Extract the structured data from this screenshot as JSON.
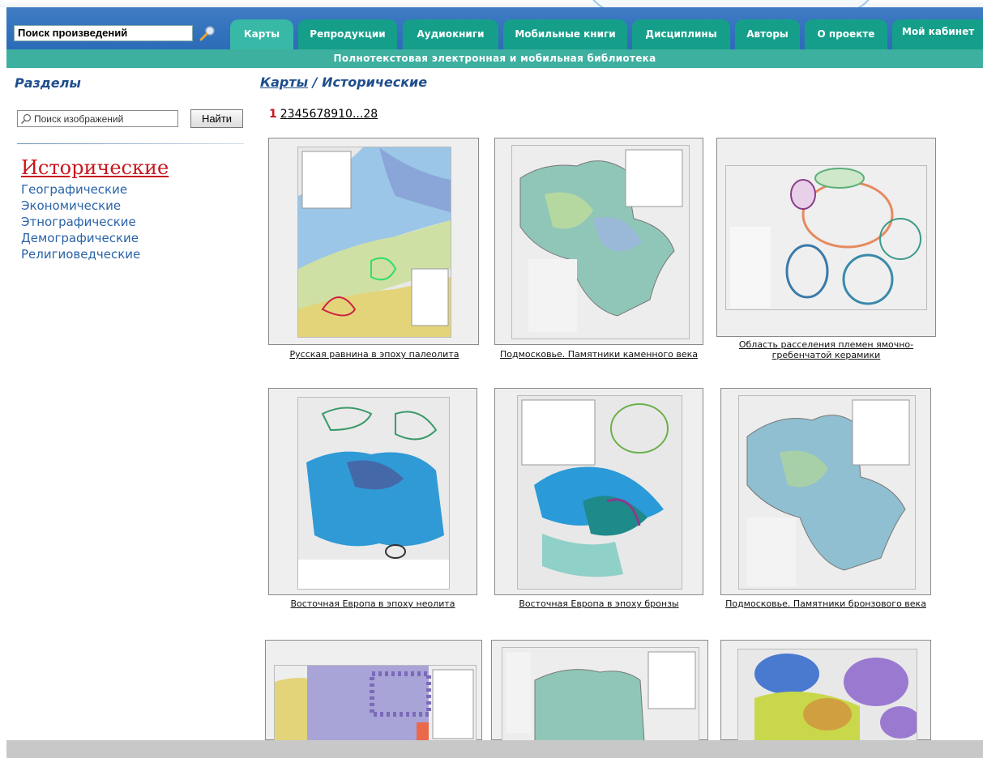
{
  "header": {
    "search_value": "Поиск произведений",
    "tabs": [
      "Карты",
      "Репродукции",
      "Аудиокниги",
      "Мобильные книги",
      "Дисциплины",
      "Авторы",
      "О проекте",
      "Мой кабинет"
    ],
    "subtitle": "Полнотекстовая электронная и мобильная библиотека",
    "colors": {
      "header_blue": "#2e6db9",
      "tab_teal": "#159f8a",
      "subbar": "#3db0a0"
    }
  },
  "sidebar": {
    "title": "Разделы",
    "search_placeholder": "Поиск изображений",
    "find_label": "Найти",
    "active_category": "Исторические",
    "categories": [
      "Географические",
      "Экономические",
      "Этнографические",
      "Демографические",
      "Религиоведческие"
    ]
  },
  "breadcrumb": {
    "root": "Карты",
    "separator": " / ",
    "current": "Исторические"
  },
  "pagination": {
    "current": "1",
    "pages": [
      "2",
      "3",
      "4",
      "5",
      "6",
      "7",
      "8",
      "9",
      "10",
      "...",
      "28"
    ]
  },
  "gallery": {
    "captions": [
      "Русская равнина в эпоху палеолита",
      "Подмосковье. Памятники каменного века",
      "Область расселения племен ямочно-гребенчатой керамики",
      "Восточная Европа в эпоху неолита",
      "Восточная Европа в эпоху бронзы",
      "Подмосковье. Памятники бронзового века"
    ]
  }
}
